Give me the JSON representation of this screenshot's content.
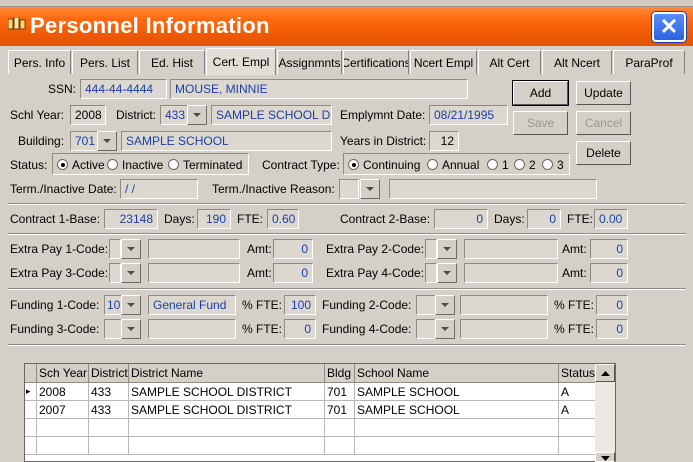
{
  "window": {
    "title": "Personnel Information",
    "close_glyph": "✕"
  },
  "tabs": [
    {
      "label": "Pers. Info"
    },
    {
      "label": "Pers. List"
    },
    {
      "label": "Ed. Hist"
    },
    {
      "label": "Cert. Empl",
      "selected": true
    },
    {
      "label": "Assignmnts"
    },
    {
      "label": "Certifications"
    },
    {
      "label": "Ncert Empl"
    },
    {
      "label": "Alt Cert"
    },
    {
      "label": "Alt Ncert"
    },
    {
      "label": "ParaProf"
    }
  ],
  "form": {
    "ssn_label": "SSN:",
    "ssn": "444-44-4444",
    "name": "MOUSE, MINNIE",
    "schl_year_label": "Schl Year:",
    "schl_year": "2008",
    "district_label": "District:",
    "district": "433",
    "district_name": "SAMPLE SCHOOL D",
    "emp_date_label": "Emplymnt Date:",
    "emp_date": "08/21/1995",
    "building_label": "Building:",
    "building": "701",
    "building_name": "SAMPLE SCHOOL",
    "years_label": "Years in District:",
    "years": "12",
    "status_label": "Status:",
    "status_opts": [
      "Active",
      "Inactive",
      "Terminated"
    ],
    "contract_type_label": "Contract Type:",
    "contract_opts": [
      "Continuing",
      "Annual",
      "1",
      "2",
      "3"
    ],
    "term_date_label": "Term./Inactive Date:",
    "term_date": " / /",
    "term_reason_label": "Term./Inactive Reason:",
    "c1_label": "Contract 1-Base:",
    "c1_base": "23148",
    "c1_days_label": "Days:",
    "c1_days": "190",
    "c1_fte_label": "FTE:",
    "c1_fte": "0.60",
    "c2_label": "Contract 2-Base:",
    "c2_base": "0",
    "c2_days_label": "Days:",
    "c2_days": "0",
    "c2_fte_label": "FTE:",
    "c2_fte": "0.00",
    "ep1_label": "Extra Pay 1-Code:",
    "ep2_label": "Extra Pay 2-Code:",
    "ep3_label": "Extra Pay 3-Code:",
    "ep4_label": "Extra Pay 4-Code:",
    "amt_label": "Amt:",
    "ep1_amt": "0",
    "ep2_amt": "0",
    "ep3_amt": "0",
    "ep4_amt": "0",
    "f1_label": "Funding 1-Code:",
    "f1_code": "10",
    "f1_name": "General Fund",
    "f2_label": "Funding 2-Code:",
    "f3_label": "Funding 3-Code:",
    "f4_label": "Funding 4-Code:",
    "pfte_label": "% FTE:",
    "f1_fte": "100",
    "f2_fte": "0",
    "f3_fte": "0",
    "f4_fte": "0"
  },
  "buttons": {
    "add": "Add",
    "update": "Update",
    "save": "Save",
    "cancel": "Cancel",
    "delete": "Delete"
  },
  "grid": {
    "columns": [
      "Sch Year",
      "District",
      "District Name",
      "Bldg",
      "School Name",
      "Status"
    ],
    "rows": [
      {
        "year": "2008",
        "district": "433",
        "district_name": "SAMPLE SCHOOL DISTRICT",
        "bldg": "701",
        "school": "SAMPLE SCHOOL",
        "status": "A"
      },
      {
        "year": "2007",
        "district": "433",
        "district_name": "SAMPLE SCHOOL DISTRICT",
        "bldg": "701",
        "school": "SAMPLE SCHOOL",
        "status": "A"
      }
    ],
    "current_row_marker": "▸"
  }
}
